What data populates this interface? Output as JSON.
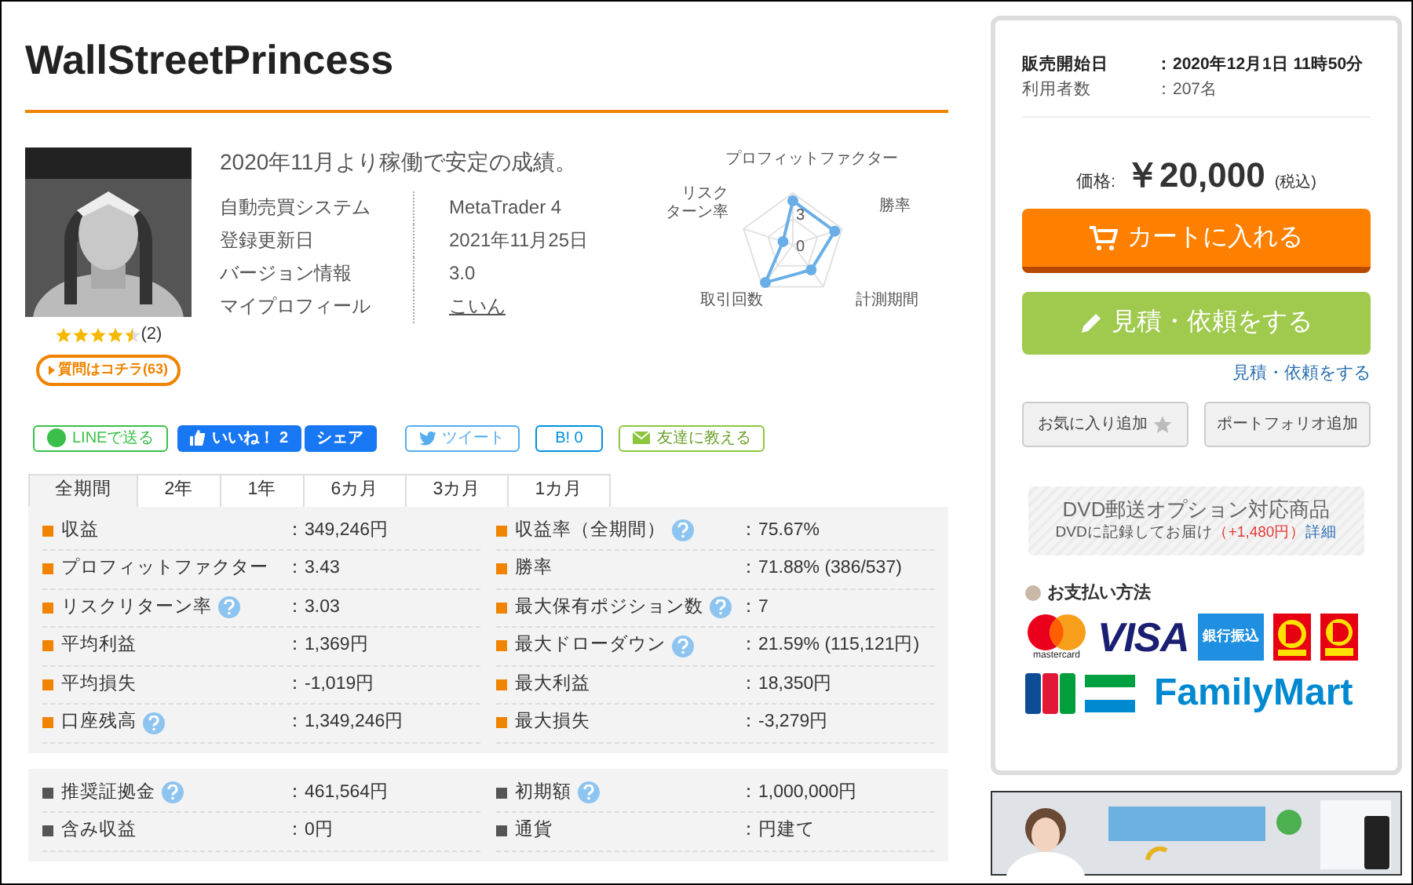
{
  "title": "WallStreetPrincess",
  "summary": "2020年11月より稼働で安定の成績。",
  "info": [
    {
      "label": "自動売買システム",
      "value": "MetaTrader 4",
      "kind": "text"
    },
    {
      "label": "登録更新日",
      "value": "2021年11月25日",
      "kind": "text"
    },
    {
      "label": "バージョン情報",
      "value": "3.0",
      "kind": "text"
    },
    {
      "label": "マイプロフィール",
      "value": "こいん",
      "kind": "link"
    }
  ],
  "rating": {
    "stars": 4.5,
    "count": "(2)"
  },
  "question_button": "質問はコチラ(63)",
  "radar": {
    "labels": [
      "プロフィットファクター",
      "勝率",
      "計測期間",
      "取引回数",
      "リスクターン率"
    ],
    "tick_labels": [
      "3",
      "0"
    ]
  },
  "share": [
    {
      "label": "LINEで送る",
      "kind": "line"
    },
    {
      "label": "いいね！ 2",
      "kind": "like"
    },
    {
      "label": "シェア",
      "kind": "fbshare"
    },
    {
      "label": "ツイート",
      "kind": "tweet"
    },
    {
      "label": "B! 0",
      "kind": "hatena"
    },
    {
      "label": "友達に教える",
      "kind": "mail"
    }
  ],
  "tabs": [
    {
      "label": "全期間",
      "selected": true
    },
    {
      "label": "2年",
      "selected": false
    },
    {
      "label": "1年",
      "selected": false
    },
    {
      "label": "6カ月",
      "selected": false
    },
    {
      "label": "3カ月",
      "selected": false
    },
    {
      "label": "1カ月",
      "selected": false
    }
  ],
  "panels": [
    {
      "kind": "performance",
      "rows": [
        [
          {
            "label": "収益",
            "value": "：349,246円",
            "help": false
          },
          {
            "label": "収益率（全期間）",
            "value": "：75.67%",
            "help": true
          }
        ],
        [
          {
            "label": "プロフィットファクター",
            "value": "：3.43",
            "help": false
          },
          {
            "label": "勝率",
            "value": "：71.88% (386/537)",
            "help": false
          }
        ],
        [
          {
            "label": "リスクリターン率",
            "value": "：3.03",
            "help": true
          },
          {
            "label": "最大保有ポジション数",
            "value": "：7",
            "help": true
          }
        ],
        [
          {
            "label": "平均利益",
            "value": "：1,369円",
            "help": false
          },
          {
            "label": "最大ドローダウン",
            "value": "：21.59% (115,121円)",
            "help": true
          }
        ],
        [
          {
            "label": "平均損失",
            "value": "：-1,019円",
            "help": false
          },
          {
            "label": "最大利益",
            "value": "：18,350円",
            "help": false
          }
        ],
        [
          {
            "label": "口座残高",
            "value": "：1,349,246円",
            "help": true
          },
          {
            "label": "最大損失",
            "value": "：-3,279円",
            "help": false
          }
        ]
      ]
    },
    {
      "kind": "account",
      "rows": [
        [
          {
            "label": "推奨証拠金",
            "value": "：461,564円",
            "help": true
          },
          {
            "label": "初期額",
            "value": "：1,000,000円",
            "help": true
          }
        ],
        [
          {
            "label": "含み収益",
            "value": "：0円",
            "help": false
          },
          {
            "label": "通貨",
            "value": "：円建て",
            "help": false
          }
        ]
      ]
    }
  ],
  "sale": [
    {
      "label": "販売開始日",
      "value": "：2020年12月1日 11時50分",
      "bold": true
    },
    {
      "label": "利用者数",
      "value": "：207名",
      "bold": false
    }
  ],
  "price": {
    "label": "価格:",
    "amount": "￥20,000",
    "tax": "(税込)"
  },
  "cart_button": "カートに入れる",
  "quote_button": "見積・依頼をする",
  "quote_link": "見積・依頼をする",
  "secondary_buttons": [
    {
      "label": "お気に入り追加",
      "kind": "favorite"
    },
    {
      "label": "ポートフォリオ追加",
      "kind": "plain"
    }
  ],
  "dvd": {
    "title": "DVD郵送オプション対応商品",
    "note": "DVDに記録してお届け",
    "extra": "（+1,480円）",
    "link": "詳細"
  },
  "payment": {
    "heading": "お支払い方法",
    "methods": [
      {
        "kind": "mastercard",
        "label": "mastercard"
      },
      {
        "kind": "visa",
        "label": "VISA"
      },
      {
        "kind": "bank",
        "label": "銀行振込"
      },
      {
        "kind": "d1"
      },
      {
        "kind": "d2"
      },
      {
        "kind": "jcb"
      },
      {
        "kind": "familymart",
        "label": "FamilyMart"
      }
    ]
  }
}
